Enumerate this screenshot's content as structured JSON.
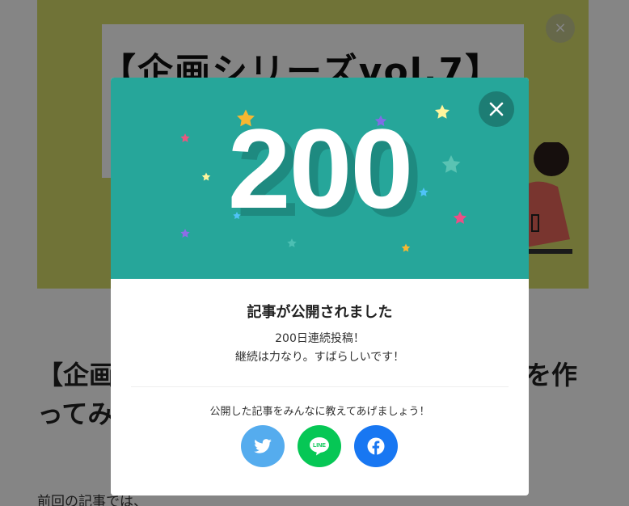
{
  "background": {
    "hero_title": "【企画シリーズvol.7】",
    "hero_close_icon": "×",
    "article_title_left": "【企画",
    "article_title_right": "を作",
    "article_title_line2": "ってみ",
    "article_body": "前回の記事では、"
  },
  "modal": {
    "number": "200",
    "title": "記事が公開されました",
    "message_line1": "200日連続投稿！",
    "message_line2": "継続は力なり。すばらしいです！",
    "share_prompt": "公開した記事をみんなに教えてあげましょう！",
    "close_icon": "close-icon",
    "share_buttons": [
      {
        "name": "twitter",
        "icon": "twitter-icon",
        "color": "#55acee"
      },
      {
        "name": "line",
        "icon": "line-icon",
        "label": "LINE",
        "color": "#06c755"
      },
      {
        "name": "facebook",
        "icon": "facebook-icon",
        "color": "#1877f2"
      }
    ],
    "header_color": "#26a69a"
  }
}
